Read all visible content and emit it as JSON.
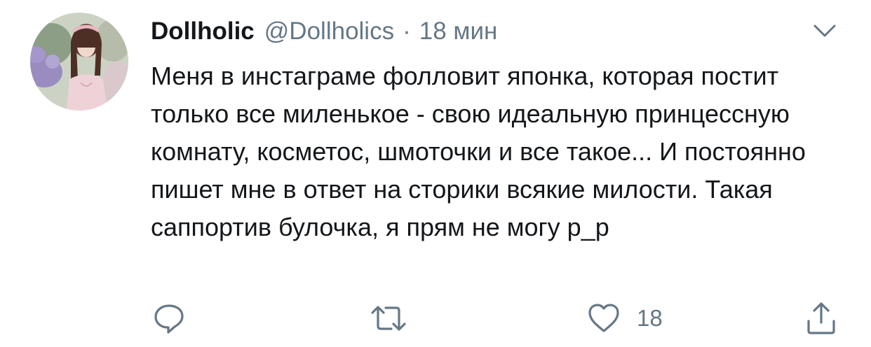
{
  "tweet": {
    "author": {
      "display_name": "Dollholic",
      "handle": "@Dollholics",
      "avatar_icon": "profile-photo"
    },
    "separator": "·",
    "time": "18 мин",
    "text": "Меня в инстаграме фолловит японка, которая постит только все миленькое - свою идеальную принцессную комнату, косметос, шмоточки и все такое... И постоянно пишет мне в ответ на сторики всякие милости. Такая саппортив булочка, я прям не могу р_р",
    "actions": {
      "reply": {
        "icon": "reply-icon"
      },
      "retweet": {
        "icon": "retweet-icon"
      },
      "like": {
        "icon": "heart-icon",
        "count": "18"
      },
      "share": {
        "icon": "share-icon"
      }
    },
    "menu_icon": "chevron-down-icon"
  },
  "colors": {
    "text": "#14171a",
    "secondary": "#657786"
  }
}
